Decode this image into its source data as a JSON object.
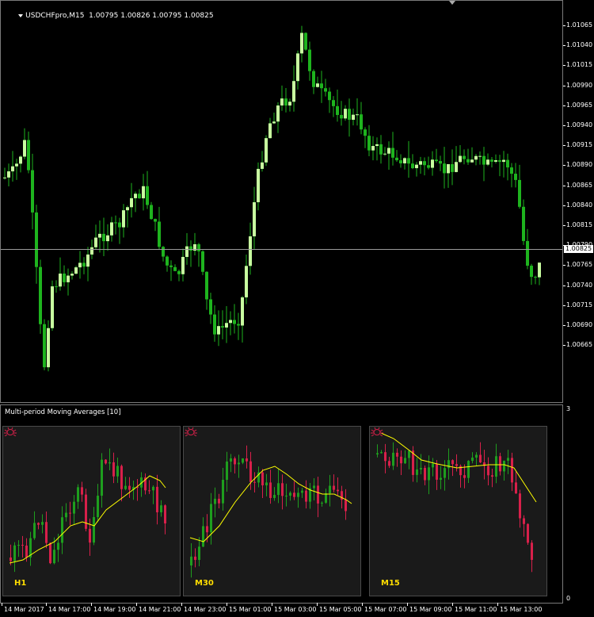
{
  "chart": {
    "symbol_line": "USDCHFpro,M15  1.00795 1.00826 1.00795 1.00825",
    "bid_label": "1.00825",
    "price_ticks": [
      "1.01065",
      "1.01040",
      "1.01015",
      "1.00990",
      "1.00965",
      "1.00940",
      "1.00915",
      "1.00890",
      "1.00865",
      "1.00840",
      "1.00815",
      "1.00790",
      "1.00765",
      "1.00740",
      "1.00715",
      "1.00690",
      "1.00665"
    ],
    "time_labels": [
      "14 Mar 2017",
      "14 Mar 17:00",
      "14 Mar 19:00",
      "14 Mar 21:00",
      "14 Mar 23:00",
      "15 Mar 01:00",
      "15 Mar 03:00",
      "15 Mar 05:00",
      "15 Mar 07:00",
      "15 Mar 09:00",
      "15 Mar 11:00",
      "15 Mar 13:00"
    ],
    "bull_color": "#c8ffa0",
    "bear_color": "#1eb41e",
    "wick_color": "#1eb41e"
  },
  "indicator": {
    "title": "Multi-period Moving Averages [10]",
    "axis_top": "3",
    "axis_bottom": "0",
    "panels": [
      {
        "label": "H1"
      },
      {
        "label": "M30"
      },
      {
        "label": "M15"
      }
    ],
    "up_color": "#1e9e1e",
    "down_color": "#d8204a",
    "ma_color": "#ffff00"
  }
}
